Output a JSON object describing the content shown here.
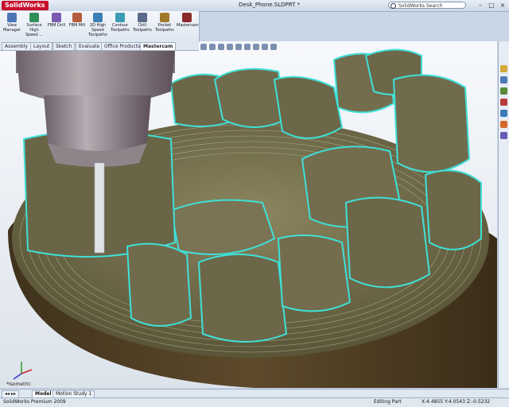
{
  "app": {
    "logo_prefix": "",
    "logo_name": "SolidWorks",
    "document_title": "Desk_Phone.SLDPRT *"
  },
  "search": {
    "placeholder": "SolidWorks Search"
  },
  "window_controls": {
    "minimize": "–",
    "maximize": "□",
    "close": "×"
  },
  "ribbon": {
    "buttons": [
      {
        "label": "View Manager",
        "icon": "view-manager-icon",
        "color": "#4a76b5"
      },
      {
        "label": "Surface High Speed ...",
        "icon": "surface-speed-icon",
        "color": "#2f8f5a"
      },
      {
        "label": "FBM Drill",
        "icon": "fbm-drill-icon",
        "color": "#7a5bb0"
      },
      {
        "label": "FBM Mill",
        "icon": "fbm-mill-icon",
        "color": "#b55a3c"
      },
      {
        "label": "2D High Speed Toolpaths",
        "icon": "highspeed-2d-icon",
        "color": "#3c7fb5"
      },
      {
        "label": "Contour Toolpaths",
        "icon": "contour-icon",
        "color": "#3c9bb5"
      },
      {
        "label": "Drill Toolpaths",
        "icon": "drill-icon",
        "color": "#5a6a8a"
      },
      {
        "label": "Pocket Toolpaths",
        "icon": "pocket-icon",
        "color": "#a07a2a"
      },
      {
        "label": "Mastercam",
        "icon": "mastercam-icon",
        "color": "#8a2a2a"
      }
    ]
  },
  "tabs": [
    "Assembly",
    "Layout",
    "Sketch",
    "Evaluate",
    "Office Products",
    "Mastercam"
  ],
  "active_tab": "Mastercam",
  "bottom_tabs": [
    "Model",
    "Motion Study 1"
  ],
  "active_bottom_tab": "Model",
  "view_label": "*Isometric",
  "status": {
    "product": "SolidWorks Premium 2009",
    "mode": "Editing Part",
    "coords": "X:4.4855  Y:4.0543  Z:-0.5232"
  },
  "colors": {
    "toolpath": "#3fe0d8",
    "part": "#6f6a4c",
    "base": "#4d3c22",
    "tool": "#8a7f86"
  }
}
